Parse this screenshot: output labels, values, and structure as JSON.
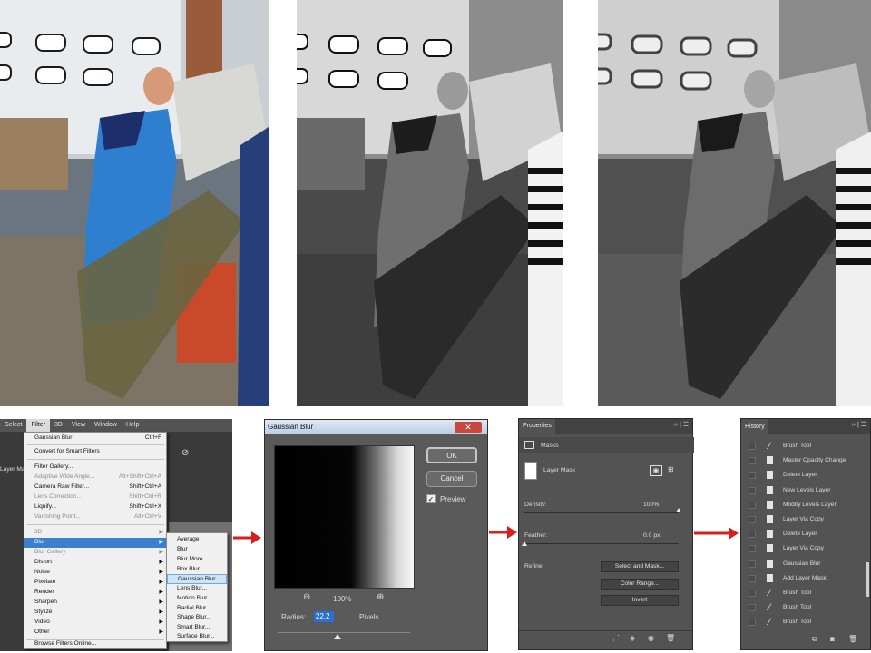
{
  "filter_menu": {
    "menubar": [
      "Select",
      "Filter",
      "3D",
      "View",
      "Window",
      "Help"
    ],
    "layer_tab_fragment": "Layer Ma",
    "items": [
      {
        "label": "Gaussian Blur",
        "shortcut": "Ctrl+F",
        "disabled": false
      },
      {
        "label": "Convert for Smart Filters",
        "shortcut": "",
        "disabled": false
      },
      {
        "label": "Filter Gallery...",
        "shortcut": "",
        "disabled": false
      },
      {
        "label": "Adaptive Wide Angle...",
        "shortcut": "Alt+Shift+Ctrl+A",
        "disabled": true
      },
      {
        "label": "Camera Raw Filter...",
        "shortcut": "Shift+Ctrl+A",
        "disabled": false
      },
      {
        "label": "Lens Correction...",
        "shortcut": "Shift+Ctrl+R",
        "disabled": true
      },
      {
        "label": "Liquify...",
        "shortcut": "Shift+Ctrl+X",
        "disabled": false
      },
      {
        "label": "Vanishing Point...",
        "shortcut": "Alt+Ctrl+V",
        "disabled": true
      },
      {
        "label": "3D",
        "shortcut": "",
        "disabled": true
      },
      {
        "label": "Blur",
        "shortcut": "",
        "disabled": false
      },
      {
        "label": "Blur Gallery",
        "shortcut": "",
        "disabled": true
      },
      {
        "label": "Distort",
        "shortcut": "",
        "disabled": false
      },
      {
        "label": "Noise",
        "shortcut": "",
        "disabled": false
      },
      {
        "label": "Pixelate",
        "shortcut": "",
        "disabled": false
      },
      {
        "label": "Render",
        "shortcut": "",
        "disabled": false
      },
      {
        "label": "Sharpen",
        "shortcut": "",
        "disabled": false
      },
      {
        "label": "Stylize",
        "shortcut": "",
        "disabled": false
      },
      {
        "label": "Video",
        "shortcut": "",
        "disabled": false
      },
      {
        "label": "Other",
        "shortcut": "",
        "disabled": false
      },
      {
        "label": "Browse Filters Online...",
        "shortcut": "",
        "disabled": false
      }
    ],
    "blur_submenu": [
      "Average",
      "Blur",
      "Blur More",
      "Box Blur...",
      "Gaussian Blur...",
      "Lens Blur...",
      "Motion Blur...",
      "Radial Blur...",
      "Shape Blur...",
      "Smart Blur...",
      "Surface Blur..."
    ],
    "selected_item": "Blur",
    "selected_subitem": "Gaussian Blur..."
  },
  "gaussian_blur_dialog": {
    "title": "Gaussian Blur",
    "close_label": "✕",
    "ok_label": "OK",
    "cancel_label": "Cancel",
    "preview_label": "Preview",
    "preview_checked": true,
    "zoom_out": "⊖",
    "zoom_level": "100%",
    "zoom_in": "⊕",
    "radius_label": "Radius:",
    "radius_value": "22.2",
    "radius_unit": "Pixels"
  },
  "properties_panel": {
    "tab": "Properties",
    "controls": "›› | ☰",
    "section": "Masks",
    "layer_mask_label": "Layer Mask",
    "density_label": "Density:",
    "density_value": "100%",
    "density_fraction": 1.0,
    "feather_label": "Feather:",
    "feather_value": "0.0 px",
    "feather_fraction": 0.0,
    "refine_label": "Refine:",
    "buttons": [
      "Select and Mask...",
      "Color Range...",
      "Invert"
    ]
  },
  "history_panel": {
    "tab": "History",
    "controls": "›› | ☰",
    "items": [
      {
        "label": "Brush Tool",
        "icon": "brush-icon"
      },
      {
        "label": "Master Opacity Change",
        "icon": "document-icon"
      },
      {
        "label": "Delete Layer",
        "icon": "document-icon"
      },
      {
        "label": "New Levels Layer",
        "icon": "document-icon"
      },
      {
        "label": "Modify Levels Layer",
        "icon": "document-icon"
      },
      {
        "label": "Layer Via Copy",
        "icon": "document-icon"
      },
      {
        "label": "Delete Layer",
        "icon": "document-icon"
      },
      {
        "label": "Layer Via Copy",
        "icon": "document-icon"
      },
      {
        "label": "Gaussian Blur",
        "icon": "document-icon"
      },
      {
        "label": "Add Layer Mask",
        "icon": "document-icon"
      },
      {
        "label": "Brush Tool",
        "icon": "brush-icon"
      },
      {
        "label": "Brush Tool",
        "icon": "brush-icon"
      },
      {
        "label": "Brush Tool",
        "icon": "brush-icon"
      }
    ]
  },
  "colors": {
    "arrow": "#d81e1e",
    "menu_highlight": "#3a7fd0",
    "panel_bg": "#535353"
  }
}
